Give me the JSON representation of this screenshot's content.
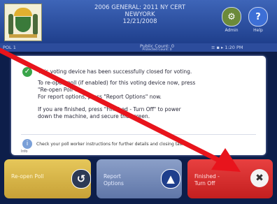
{
  "header": {
    "title_lines": [
      "2006 GENERAL: 2011 NY CERT",
      "NEWYORK",
      "12/21/2008"
    ],
    "admin_label": "Admin",
    "help_label": "Help",
    "admin_icon": "wrench-icon",
    "help_icon": "question-icon",
    "seal": "New York State seal"
  },
  "status": {
    "left": "POL 1",
    "mid_line1": "Public Count: 0",
    "mid_line2": "Protected Count: 0",
    "right": "≡  ▪  ▸  1:20 PM"
  },
  "message": {
    "line1": "This voting device has been successfully closed for voting.",
    "line2a": "To re-open poll (if enabled) for this voting device now, press",
    "line2b": "\"Re-open Poll\".",
    "line3": "For report options, press \"Report Options\" now.",
    "line4a": "If you are finished, press \"Finished - Turn Off\" to power",
    "line4b": "down the machine, and secure the screen.",
    "note": "Check your poll worker instructions for further details and closing tasks.",
    "info_label": "Info"
  },
  "buttons": {
    "reopen_line1": "Re-open Poll",
    "report_line1": "Report",
    "report_line2": "Options",
    "finish_line1": "Finished -",
    "finish_line2": "Turn Off"
  },
  "colors": {
    "header": "#1f3f8c",
    "reopen": "#c7a137",
    "report": "#5f76a8",
    "finish": "#c41f1f",
    "arrow": "#e8141c",
    "check": "#3aa54a"
  }
}
